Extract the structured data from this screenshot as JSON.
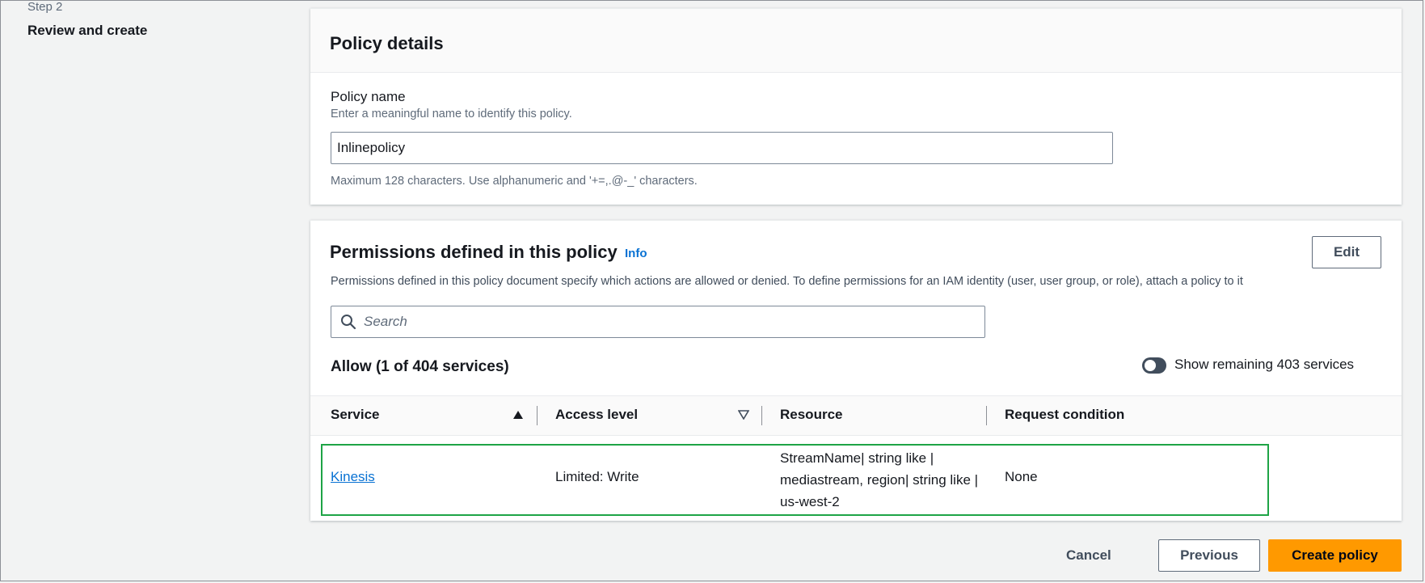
{
  "sidebar": {
    "step_label": "Step 2",
    "step_title": "Review and create"
  },
  "policy_details": {
    "title": "Policy details",
    "name_label": "Policy name",
    "name_description": "Enter a meaningful name to identify this policy.",
    "name_value": "Inlinepolicy",
    "name_constraint": "Maximum 128 characters. Use alphanumeric and '+=,.@-_' characters."
  },
  "permissions": {
    "title": "Permissions defined in this policy",
    "info_link": "Info",
    "edit_label": "Edit",
    "description": "Permissions defined in this policy document specify which actions are allowed or denied. To define permissions for an IAM identity (user, user group, or role), attach a policy to it",
    "search_placeholder": "Search",
    "allow_title": "Allow (1 of 404 services)",
    "toggle_label": "Show remaining 403 services",
    "toggle_on": false,
    "columns": [
      "Service",
      "Access level",
      "Resource",
      "Request condition"
    ],
    "rows": [
      {
        "service": "Kinesis",
        "access_level": "Limited: Write",
        "resource_lines": [
          "StreamName| string like |",
          "mediastream, region| string like |",
          "us-west-2"
        ],
        "request_condition": "None"
      }
    ]
  },
  "footer": {
    "cancel_label": "Cancel",
    "previous_label": "Previous",
    "create_label": "Create policy"
  },
  "colors": {
    "primary_button": "#ff9900",
    "link": "#0972d3",
    "highlight_border": "#1ea446"
  }
}
